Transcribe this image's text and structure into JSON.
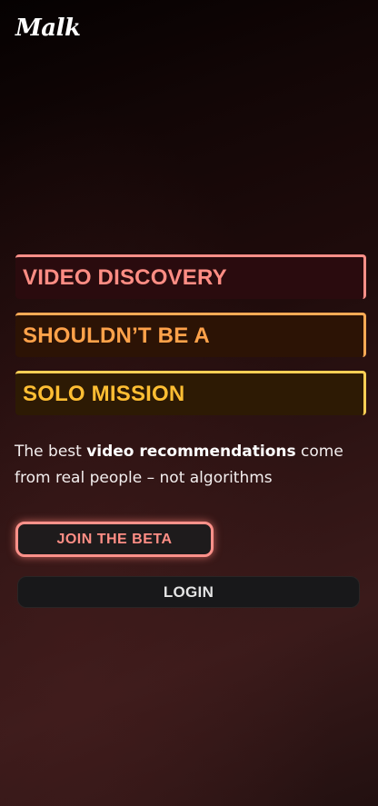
{
  "app": {
    "logo_text": "Malk"
  },
  "hero": {
    "line1": "VIDEO DISCOVERY",
    "line2": "SHOULDN’T BE A",
    "line3": "SOLO MISSION"
  },
  "tagline": {
    "prefix": "The best ",
    "bold": "video recommendations",
    "suffix": " come from real people – not algorithms"
  },
  "actions": {
    "join_label": "JOIN THE BETA",
    "login_label": "LOGIN"
  },
  "colors": {
    "accent_pink": "#ff8d84",
    "accent_orange": "#ffa24a",
    "accent_yellow": "#ffbe33"
  }
}
